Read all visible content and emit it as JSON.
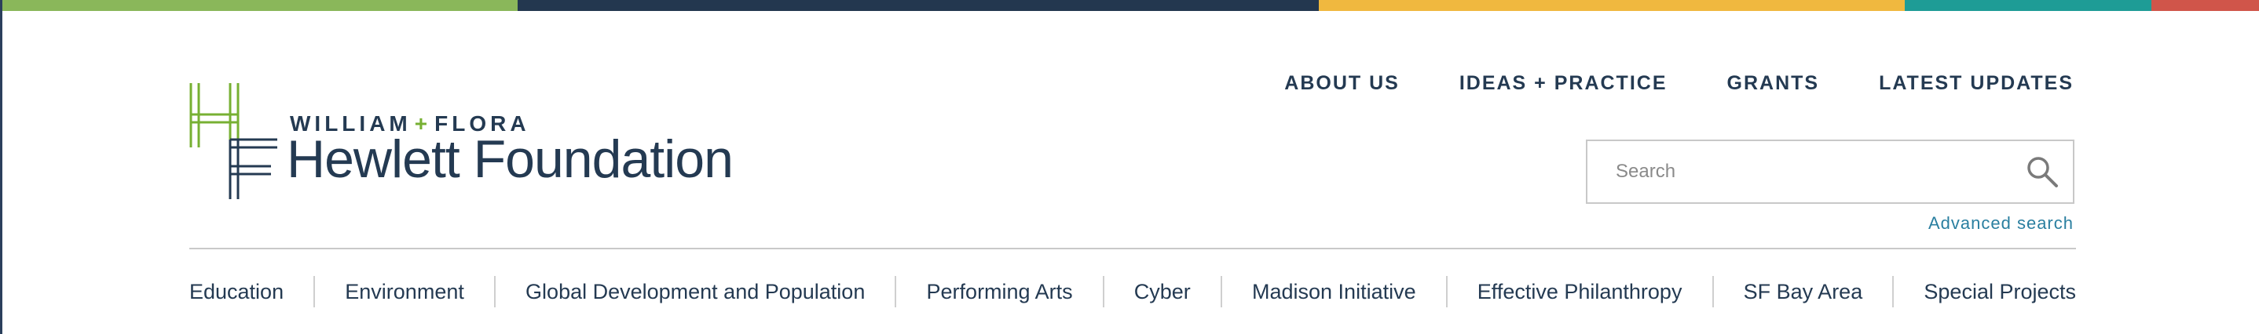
{
  "colors": {
    "navy": "#243a52",
    "green": "#77b033",
    "link_blue": "#2a7fa0",
    "bar_green": "#8ab75a",
    "bar_navy": "#23374f",
    "bar_yellow": "#f0b83f",
    "bar_teal": "#1e9c96",
    "bar_red": "#d0554a"
  },
  "logo": {
    "icon": "hf-monogram-icon",
    "sub_left": "WILLIAM",
    "sub_plus": "+",
    "sub_right": "FLORA",
    "main": "Hewlett Foundation"
  },
  "top_nav": {
    "items": [
      "ABOUT US",
      "IDEAS + PRACTICE",
      "GRANTS",
      "LATEST UPDATES"
    ]
  },
  "search": {
    "placeholder": "Search",
    "value": "",
    "icon": "search-icon",
    "advanced_link": "Advanced search"
  },
  "sub_nav": {
    "items": [
      "Education",
      "Environment",
      "Global Development and Population",
      "Performing Arts",
      "Cyber",
      "Madison Initiative",
      "Effective Philanthropy",
      "SF Bay Area",
      "Special Projects"
    ]
  }
}
